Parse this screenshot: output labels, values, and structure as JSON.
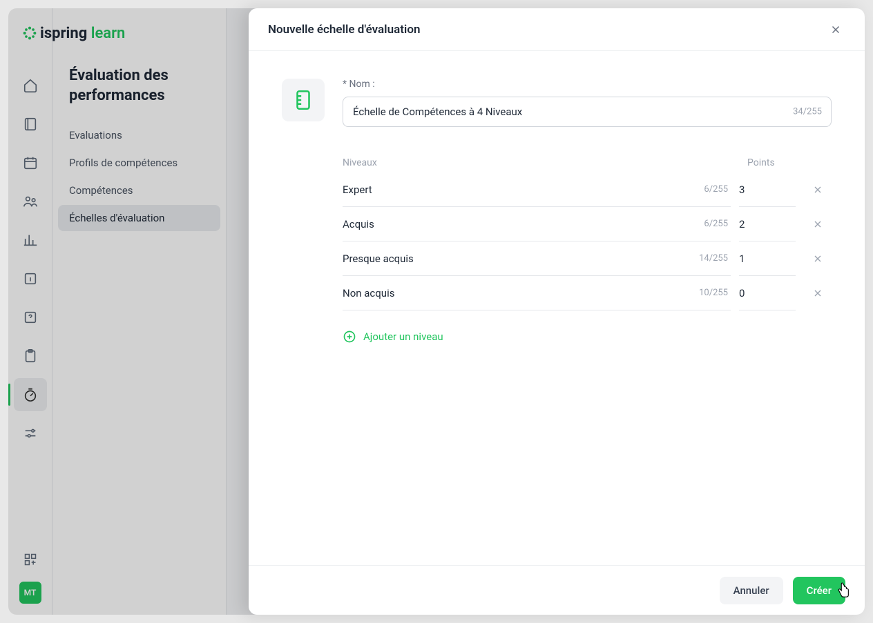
{
  "brand": {
    "name": "ispring",
    "suffix": "learn"
  },
  "sidebar": {
    "title": "Évaluation des performances",
    "items": [
      {
        "label": "Evaluations"
      },
      {
        "label": "Profils de compétences"
      },
      {
        "label": "Compétences"
      },
      {
        "label": "Échelles d'évaluation"
      }
    ]
  },
  "avatar": "MT",
  "modal": {
    "title": "Nouvelle échelle d'évaluation",
    "name_label": "* Nom :",
    "name_value": "Échelle de Compétences à 4 Niveaux",
    "name_count": "34/255",
    "levels_header": "Niveaux",
    "points_header": "Points",
    "levels": [
      {
        "name": "Expert",
        "count": "6/255",
        "points": "3"
      },
      {
        "name": "Acquis",
        "count": "6/255",
        "points": "2"
      },
      {
        "name": "Presque acquis",
        "count": "14/255",
        "points": "1"
      },
      {
        "name": "Non acquis",
        "count": "10/255",
        "points": "0"
      }
    ],
    "add_level": "Ajouter un niveau",
    "cancel": "Annuler",
    "create": "Créer"
  }
}
